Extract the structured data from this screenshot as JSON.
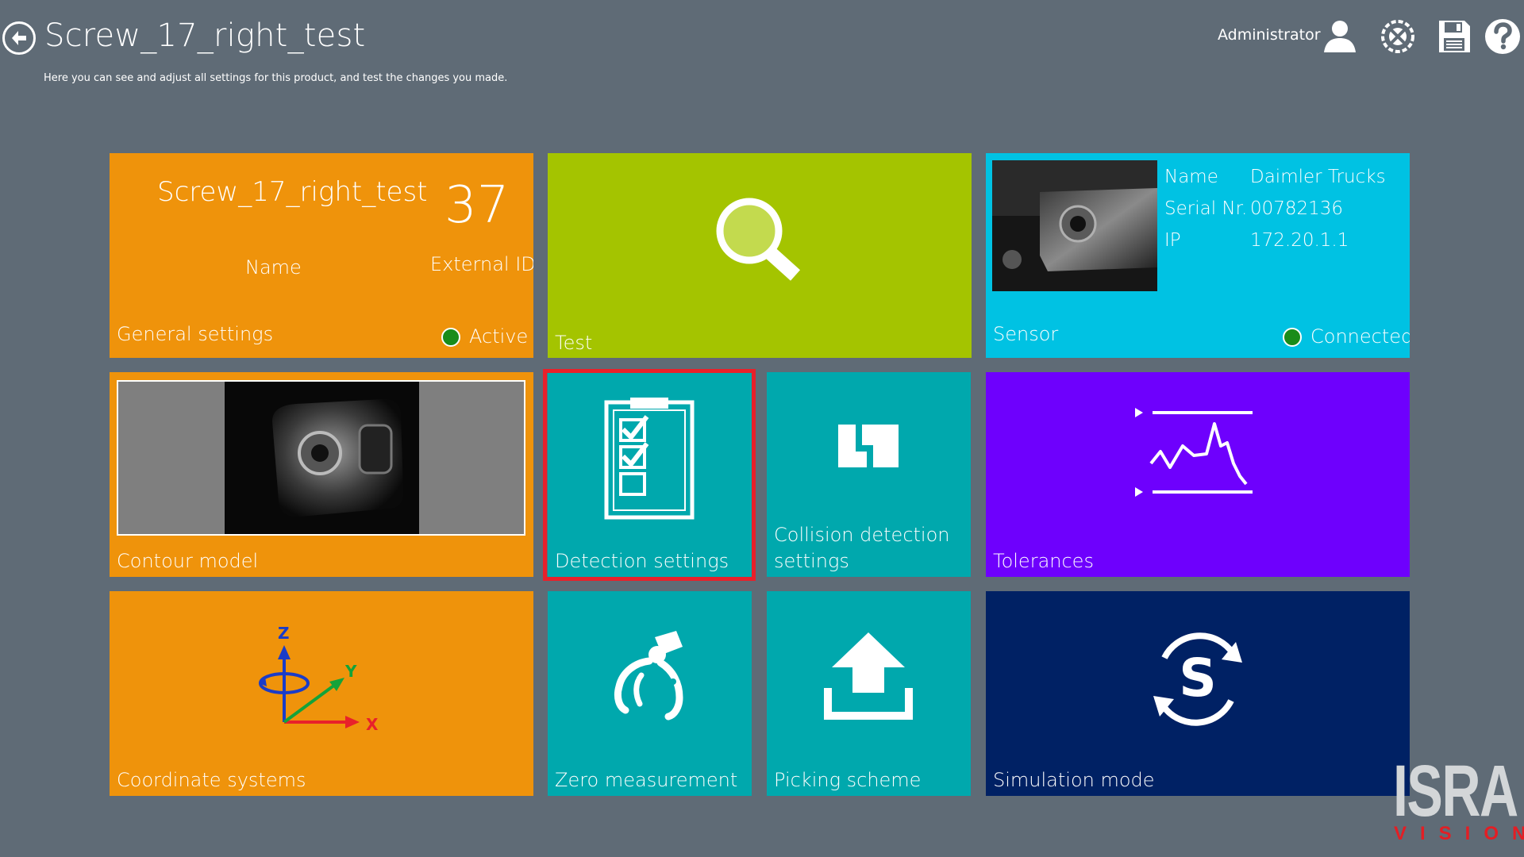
{
  "header": {
    "title": "Screw_17_right_test",
    "subtitle": "Here you can see and adjust all settings for this product, and test the changes you made.",
    "user": "Administrator",
    "icons": [
      "back-icon",
      "user-icon",
      "service-tools-icon",
      "save-icon",
      "help-icon"
    ]
  },
  "general": {
    "product_name": "Screw_17_right_test",
    "name_caption": "Name",
    "external_id": "37",
    "external_id_caption": "External ID",
    "label": "General settings",
    "status": "Active",
    "status_color": "#1a8c1a"
  },
  "test": {
    "label": "Test"
  },
  "sensor": {
    "name_key": "Name",
    "name_value": "Daimler Trucks",
    "serial_key": "Serial Nr.",
    "serial_value": "00782136",
    "ip_key": "IP",
    "ip_value": "172.20.1.1",
    "label": "Sensor",
    "status": "Connected",
    "status_color": "#1a8c1a"
  },
  "tiles": {
    "contour_model": "Contour model",
    "detection_settings": "Detection settings",
    "collision_line1": "Collision detection",
    "collision_line2": "settings",
    "tolerances": "Tolerances",
    "coordinate_systems": "Coordinate systems",
    "zero_measurement": "Zero measurement",
    "picking_scheme": "Picking scheme",
    "simulation_mode": "Simulation mode"
  },
  "axes": {
    "z": "Z",
    "y": "Y",
    "x": "X"
  },
  "simulation_symbol": "S",
  "logo": {
    "brand": "ISRA",
    "tagline": "VISION"
  },
  "colors": {
    "background": "#5f6b76",
    "orange": "#ef930b",
    "lime": "#a4c400",
    "cyan": "#00c2e3",
    "teal": "#00a8ad",
    "violet": "#6e00fd",
    "navy": "#002164",
    "selection": "#e8202a"
  }
}
